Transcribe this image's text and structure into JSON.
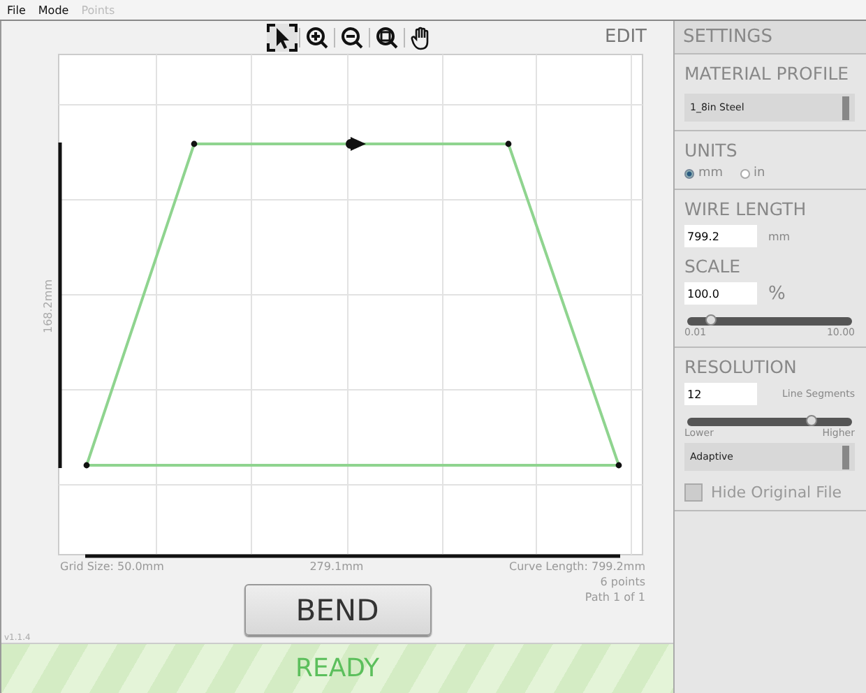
{
  "menu": [
    {
      "label": "File",
      "disabled": false
    },
    {
      "label": "Mode",
      "disabled": false
    },
    {
      "label": "Points",
      "disabled": true
    }
  ],
  "tools": [
    {
      "kind": "pointer",
      "selected": true
    },
    {
      "kind": "zoom-in",
      "selected": false
    },
    {
      "kind": "zoom-out",
      "selected": false
    },
    {
      "kind": "zoom-fit",
      "selected": false
    },
    {
      "kind": "pan",
      "selected": false
    }
  ],
  "mode_label": "EDIT",
  "canvas": {
    "height_label": "168.2mm",
    "grid_size": "Grid Size: 50.0mm",
    "width_label": "279.1mm",
    "curve_length": "Curve Length: 799.2mm",
    "points": "6 points",
    "path": "Path 1 of 1"
  },
  "bend_button": "BEND",
  "version": "v1.1.4",
  "status": "READY",
  "settings": {
    "title": "SETTINGS",
    "material_profile": {
      "label": "MATERIAL PROFILE",
      "value": "1_8in Steel"
    },
    "units": {
      "label": "UNITS",
      "options": [
        {
          "label": "mm",
          "selected": true
        },
        {
          "label": "in",
          "selected": false
        }
      ]
    },
    "wire_length": {
      "label": "WIRE LENGTH",
      "value": "799.2",
      "unit": "mm"
    },
    "scale": {
      "label": "SCALE",
      "value": "100.0",
      "unit": "%",
      "level": 0.14,
      "min": "0.01",
      "max": "10.00"
    },
    "resolution": {
      "label": "RESOLUTION",
      "value": "12",
      "unit": "Line Segments",
      "level": 0.75,
      "min": "Lower",
      "max": "Higher",
      "mode": "Adaptive"
    },
    "hide_original": {
      "label": "Hide Original File",
      "checked": false
    }
  }
}
